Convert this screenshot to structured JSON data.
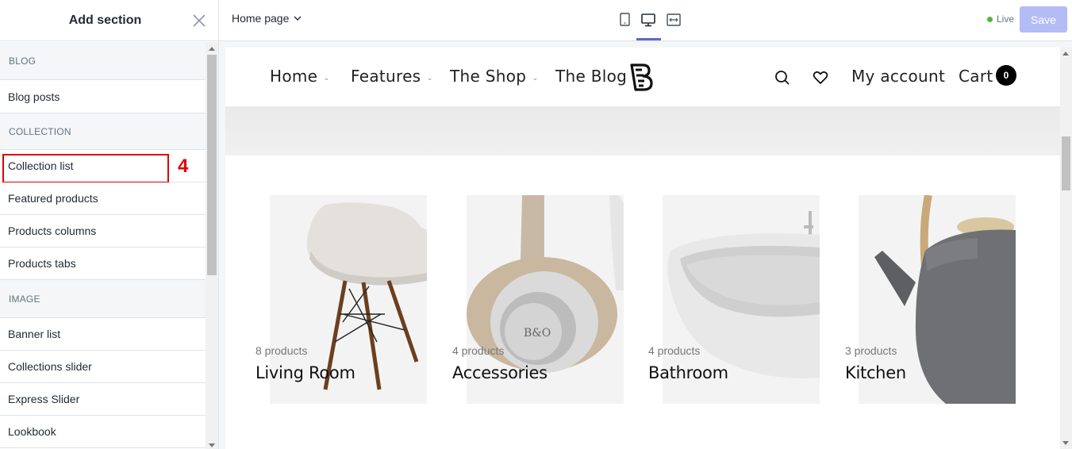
{
  "sidebar": {
    "title": "Add section",
    "step_number": "4",
    "groups": [
      {
        "title": "BLOG",
        "items": [
          "Blog posts"
        ]
      },
      {
        "title": "COLLECTION",
        "items": [
          "Collection list",
          "Featured products",
          "Products columns",
          "Products tabs"
        ]
      },
      {
        "title": "IMAGE",
        "items": [
          "Banner list",
          "Collections slider",
          "Express Slider",
          "Lookbook"
        ]
      }
    ]
  },
  "topbar": {
    "page_select": "Home page",
    "device_buttons": [
      "mobile-icon",
      "desktop-icon",
      "fullwidth-icon"
    ],
    "live_label": "Live",
    "save_label": "Save"
  },
  "store": {
    "nav": [
      "Home",
      "Features",
      "The Shop",
      "The Blog"
    ],
    "account_label": "My account",
    "cart_label": "Cart",
    "cart_count": "0",
    "collections": [
      {
        "count": "8 products",
        "title": "Living Room"
      },
      {
        "count": "4 products",
        "title": "Accessories"
      },
      {
        "count": "4 products",
        "title": "Bathroom"
      },
      {
        "count": "3 products",
        "title": "Kitchen"
      }
    ]
  },
  "colors": {
    "accent": "#5c6ac4",
    "save_disabled": "#b3bcf5",
    "live": "#50b83c",
    "highlight": "#e00000"
  }
}
